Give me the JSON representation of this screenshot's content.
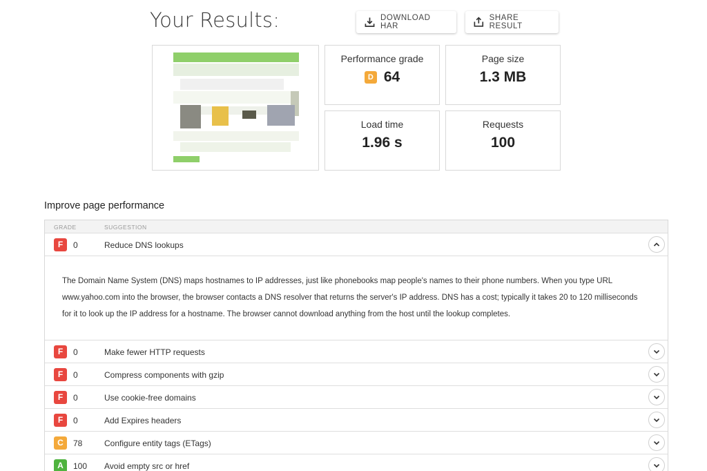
{
  "header": {
    "title": "Your Results:",
    "download_label": "DOWNLOAD HAR",
    "share_label": "SHARE RESULT"
  },
  "metrics": {
    "performance": {
      "label": "Performance grade",
      "grade": "D",
      "value": "64",
      "grade_color": "#f4a93a"
    },
    "page_size": {
      "label": "Page size",
      "value": "1.3 MB"
    },
    "load_time": {
      "label": "Load time",
      "value": "1.96 s"
    },
    "requests": {
      "label": "Requests",
      "value": "100"
    }
  },
  "improve": {
    "title": "Improve page performance",
    "col_grade": "GRADE",
    "col_suggestion": "SUGGESTION",
    "expanded_text": "The Domain Name System (DNS) maps hostnames to IP addresses, just like phonebooks map people's names to their phone numbers. When you type URL www.yahoo.com into the browser, the browser contacts a DNS resolver that returns the server's IP address. DNS has a cost; typically it takes 20 to 120 milliseconds for it to look up the IP address for a hostname. The browser cannot download anything from the host until the lookup completes.",
    "rows": [
      {
        "grade": "F",
        "score": "0",
        "suggestion": "Reduce DNS lookups",
        "color": "#e8473f"
      },
      {
        "grade": "F",
        "score": "0",
        "suggestion": "Make fewer HTTP requests",
        "color": "#e8473f"
      },
      {
        "grade": "F",
        "score": "0",
        "suggestion": "Compress components with gzip",
        "color": "#e8473f"
      },
      {
        "grade": "F",
        "score": "0",
        "suggestion": "Use cookie-free domains",
        "color": "#e8473f"
      },
      {
        "grade": "F",
        "score": "0",
        "suggestion": "Add Expires headers",
        "color": "#e8473f"
      },
      {
        "grade": "C",
        "score": "78",
        "suggestion": "Configure entity tags (ETags)",
        "color": "#f4a93a"
      },
      {
        "grade": "A",
        "score": "100",
        "suggestion": "Avoid empty src or href",
        "color": "#4fb33f"
      }
    ]
  }
}
